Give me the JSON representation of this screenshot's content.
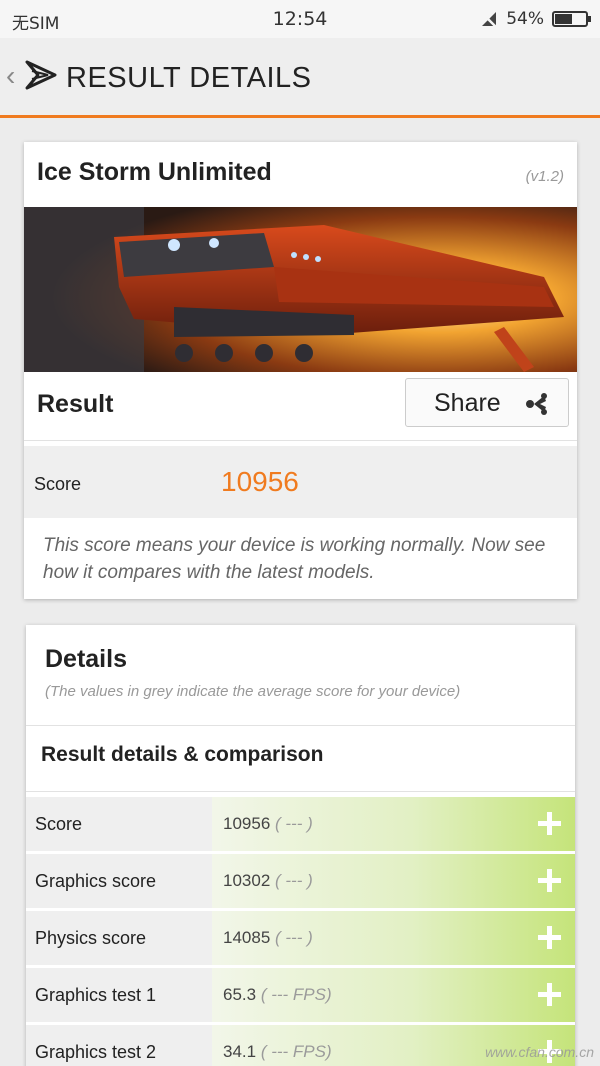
{
  "status_bar": {
    "carrier": "无SIM",
    "time": "12:54",
    "battery_percent": "54%",
    "battery_level": 0.54
  },
  "app_bar": {
    "title": "RESULT DETAILS"
  },
  "result_card": {
    "title": "Ice Storm Unlimited",
    "version": "(v1.2)",
    "result_label": "Result",
    "share_label": "Share",
    "score_label": "Score",
    "score_value": "10956",
    "description": "This score means your device is working normally. Now see how it compares with the latest models."
  },
  "details_card": {
    "title": "Details",
    "subtitle": "(The values in grey indicate the average score for your device)",
    "section_title": "Result details & comparison",
    "rows": [
      {
        "label": "Score",
        "value": "10956",
        "avg": "( --- )"
      },
      {
        "label": "Graphics score",
        "value": "10302",
        "avg": "( --- )"
      },
      {
        "label": "Physics score",
        "value": "14085",
        "avg": "( --- )"
      },
      {
        "label": "Graphics test 1",
        "value": "65.3",
        "avg": "( --- FPS)"
      },
      {
        "label": "Graphics test 2",
        "value": "34.1",
        "avg": "( --- FPS)"
      }
    ]
  },
  "watermark": "www.cfan.com.cn",
  "colors": {
    "accent": "#f07b1f",
    "row_gradient_end": "#c5e47a"
  }
}
